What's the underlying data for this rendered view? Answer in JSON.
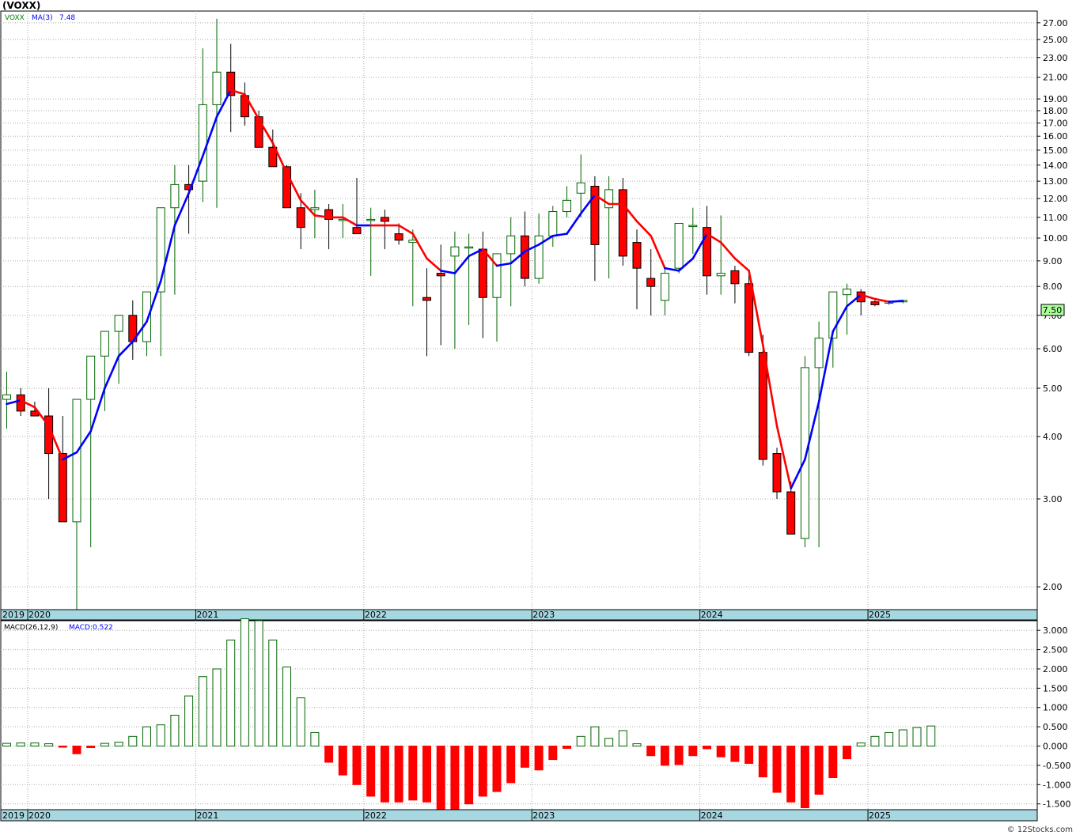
{
  "title": "(VOXX)",
  "legend": {
    "symbol": "VOXX",
    "ma_label": "MA(3)",
    "ma_value": "7.48",
    "macd_label": "MACD(26,12,9)",
    "macd_value": "MACD:0.522"
  },
  "last_price_badge": "7.50",
  "watermark": "© 12Stocks.com",
  "colors": {
    "up": "#006400",
    "down": "#ff0000",
    "ma_up": "#0000ff",
    "ma_down": "#ff0000",
    "axis_band": "#a7d7e0",
    "grid": "#aaaaaa"
  },
  "chart_data": [
    {
      "type": "candlestick",
      "title": "(VOXX)",
      "scale": "log",
      "ylim": [
        1.8,
        28.5
      ],
      "y_ticks": [
        2.0,
        3.0,
        4.0,
        5.0,
        6.0,
        7.0,
        8.0,
        9.0,
        10.0,
        11.0,
        12.0,
        13.0,
        14.0,
        15.0,
        16.0,
        17.0,
        18.0,
        19.0,
        21.0,
        23.0,
        25.0,
        27.0
      ],
      "y_tick_labels": [
        "2.00",
        "3.00",
        "4.00",
        "5.00",
        "6.00",
        "7.00",
        "8.00",
        "9.00",
        "10.00",
        "11.00",
        "12.00",
        "13.00",
        "14.00",
        "15.00",
        "16.00",
        "17.00",
        "18.00",
        "19.00",
        "21.00",
        "23.00",
        "25.00",
        "27.00"
      ],
      "x_axis_labels": [
        "2019",
        "2020",
        "2021",
        "2022",
        "2023",
        "2024",
        "2025"
      ],
      "period": "monthly",
      "x_start": "2019-11",
      "dates": [
        "2019-11",
        "2019-12",
        "2020-01",
        "2020-02",
        "2020-03",
        "2020-04",
        "2020-05",
        "2020-06",
        "2020-07",
        "2020-08",
        "2020-09",
        "2020-10",
        "2020-11",
        "2020-12",
        "2021-01",
        "2021-02",
        "2021-03",
        "2021-04",
        "2021-05",
        "2021-06",
        "2021-07",
        "2021-08",
        "2021-09",
        "2021-10",
        "2021-11",
        "2021-12",
        "2022-01",
        "2022-02",
        "2022-03",
        "2022-04",
        "2022-05",
        "2022-06",
        "2022-07",
        "2022-08",
        "2022-09",
        "2022-10",
        "2022-11",
        "2022-12",
        "2023-01",
        "2023-02",
        "2023-03",
        "2023-04",
        "2023-05",
        "2023-06",
        "2023-07",
        "2023-08",
        "2023-09",
        "2023-10",
        "2023-11",
        "2023-12",
        "2024-01",
        "2024-02",
        "2024-03",
        "2024-04",
        "2024-05",
        "2024-06",
        "2024-07",
        "2024-08",
        "2024-09",
        "2024-10",
        "2024-11",
        "2024-12",
        "2025-01",
        "2025-02",
        "2025-03"
      ],
      "open": [
        4.75,
        4.85,
        4.5,
        4.4,
        3.7,
        2.7,
        4.75,
        5.8,
        6.5,
        7.0,
        6.2,
        7.8,
        11.5,
        12.8,
        13.0,
        18.5,
        21.5,
        19.3,
        17.5,
        15.2,
        13.9,
        11.5,
        11.4,
        11.4,
        10.9,
        10.5,
        10.9,
        11.0,
        10.2,
        9.8,
        7.6,
        8.5,
        9.2,
        9.6,
        9.5,
        7.6,
        9.3,
        10.1,
        8.3,
        10.1,
        11.3,
        12.3,
        12.7,
        11.5,
        12.5,
        9.8,
        8.3,
        7.5,
        8.7,
        10.6,
        10.5,
        8.4,
        8.6,
        8.1,
        5.9,
        3.7,
        3.1,
        2.5,
        5.5,
        6.3,
        7.7,
        7.8,
        7.45,
        7.4,
        7.45
      ],
      "high": [
        5.4,
        5.0,
        4.7,
        5.0,
        4.4,
        3.8,
        5.2,
        6.3,
        6.9,
        7.5,
        7.5,
        11.2,
        14.0,
        14.0,
        24.0,
        27.5,
        24.5,
        20.5,
        18.0,
        16.5,
        14.0,
        12.3,
        12.5,
        11.7,
        11.7,
        13.2,
        11.5,
        11.4,
        10.7,
        10.4,
        8.7,
        9.7,
        10.3,
        10.2,
        10.3,
        8.8,
        11.0,
        11.3,
        11.2,
        11.6,
        12.7,
        14.7,
        13.3,
        13.3,
        13.2,
        10.4,
        9.5,
        8.7,
        10.1,
        11.5,
        11.6,
        11.1,
        8.8,
        8.5,
        6.4,
        3.8,
        3.25,
        5.8,
        6.8,
        7.8,
        8.1,
        7.9,
        7.55,
        7.5,
        7.5
      ],
      "low": [
        4.15,
        4.4,
        4.4,
        3.0,
        3.0,
        1.5,
        2.4,
        4.5,
        5.1,
        5.7,
        5.8,
        5.8,
        7.7,
        10.2,
        11.8,
        11.5,
        16.3,
        16.8,
        15.5,
        14.0,
        11.8,
        9.5,
        10.0,
        9.5,
        10.0,
        10.2,
        8.4,
        9.5,
        9.7,
        7.3,
        5.8,
        6.1,
        6.0,
        6.7,
        6.3,
        6.2,
        7.3,
        8.0,
        8.1,
        9.6,
        11.0,
        11.0,
        8.2,
        8.3,
        8.8,
        7.2,
        7.0,
        7.0,
        8.5,
        9.3,
        7.7,
        7.7,
        7.4,
        5.8,
        3.5,
        3.0,
        2.55,
        2.4,
        2.4,
        5.5,
        6.4,
        7.0,
        7.3,
        7.35,
        7.4
      ],
      "close": [
        4.85,
        4.5,
        4.4,
        3.7,
        2.7,
        4.75,
        5.8,
        6.5,
        7.0,
        6.2,
        7.8,
        11.5,
        12.8,
        12.5,
        18.5,
        21.5,
        19.3,
        17.5,
        15.2,
        13.9,
        11.5,
        10.5,
        11.5,
        10.9,
        10.9,
        10.2,
        10.9,
        10.8,
        9.9,
        9.9,
        7.5,
        8.4,
        9.6,
        9.6,
        7.6,
        9.3,
        10.1,
        8.3,
        10.1,
        11.3,
        11.9,
        12.9,
        9.7,
        12.5,
        9.2,
        8.7,
        8.0,
        8.5,
        10.7,
        10.6,
        8.4,
        8.5,
        8.1,
        5.9,
        3.6,
        3.1,
        2.55,
        5.5,
        6.3,
        7.8,
        7.9,
        7.45,
        7.35,
        7.45,
        7.5
      ],
      "ma3": [
        4.65,
        4.73,
        4.58,
        4.2,
        3.6,
        3.72,
        4.1,
        5.0,
        5.8,
        6.2,
        6.8,
        8.2,
        10.6,
        12.3,
        14.6,
        17.5,
        19.8,
        19.4,
        17.3,
        15.5,
        13.5,
        11.9,
        11.1,
        11.0,
        11.0,
        10.6,
        10.6,
        10.6,
        10.6,
        10.2,
        9.1,
        8.6,
        8.5,
        9.2,
        9.5,
        8.8,
        8.9,
        9.4,
        9.7,
        10.1,
        10.2,
        11.2,
        12.2,
        11.7,
        11.7,
        10.8,
        10.1,
        8.7,
        8.6,
        9.1,
        10.2,
        9.8,
        9.1,
        8.6,
        6.1,
        4.2,
        3.15,
        3.6,
        4.7,
        6.5,
        7.3,
        7.7,
        7.55,
        7.45,
        7.48
      ],
      "ma3_color": [
        "up",
        "up",
        "down",
        "down",
        "down",
        "up",
        "up",
        "up",
        "up",
        "up",
        "up",
        "up",
        "up",
        "up",
        "up",
        "up",
        "up",
        "down",
        "down",
        "down",
        "down",
        "down",
        "down",
        "down",
        "down",
        "down",
        "up",
        "down",
        "down",
        "down",
        "down",
        "down",
        "up",
        "up",
        "up",
        "down",
        "up",
        "up",
        "up",
        "up",
        "up",
        "up",
        "up",
        "down",
        "down",
        "down",
        "down",
        "down",
        "up",
        "up",
        "up",
        "down",
        "down",
        "down",
        "down",
        "down",
        "down",
        "up",
        "up",
        "up",
        "up",
        "up",
        "down",
        "down",
        "up"
      ]
    },
    {
      "type": "bar",
      "title": "MACD(26,12,9)",
      "ylim": [
        -1.65,
        3.25
      ],
      "y_ticks": [
        -1.5,
        -1.0,
        -0.5,
        0.0,
        0.5,
        1.0,
        1.5,
        2.0,
        2.5,
        3.0
      ],
      "y_tick_labels": [
        "-1.500",
        "-1.000",
        "-0.500",
        "0.000",
        "0.500",
        "1.000",
        "1.500",
        "2.000",
        "2.500",
        "3.000"
      ],
      "x_axis_labels": [
        "2019",
        "2020",
        "2021",
        "2022",
        "2023",
        "2024",
        "2025"
      ],
      "values": [
        0.07,
        0.08,
        0.08,
        0.06,
        -0.03,
        -0.2,
        -0.04,
        0.07,
        0.1,
        0.25,
        0.5,
        0.55,
        0.8,
        1.3,
        1.8,
        2.0,
        2.75,
        3.3,
        3.25,
        2.75,
        2.05,
        1.25,
        0.35,
        -0.42,
        -0.75,
        -1.0,
        -1.3,
        -1.45,
        -1.45,
        -1.4,
        -1.45,
        -1.65,
        -1.7,
        -1.5,
        -1.3,
        -1.18,
        -0.95,
        -0.55,
        -0.62,
        -0.35,
        -0.06,
        0.25,
        0.5,
        0.2,
        0.4,
        0.06,
        -0.25,
        -0.5,
        -0.48,
        -0.25,
        -0.07,
        -0.28,
        -0.4,
        -0.45,
        -0.8,
        -1.2,
        -1.45,
        -1.6,
        -1.25,
        -0.82,
        -0.33,
        0.08,
        0.25,
        0.35,
        0.42,
        0.48,
        0.52
      ],
      "last_value": 0.522
    }
  ]
}
